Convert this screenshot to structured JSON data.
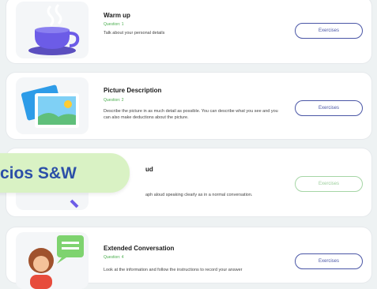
{
  "lessons": [
    {
      "title": "Warm up",
      "question": "Question: 1",
      "description": "Talk about your personal details",
      "button": "Exercises",
      "icon": "coffee-cup-icon"
    },
    {
      "title": "Picture Description",
      "question": "Question: 2",
      "description": "Describe the picture in as much detail as possible. You can describe what you see and you can also make deductions about the picture.",
      "button": "Exercises",
      "icon": "photos-icon"
    },
    {
      "title": "ud",
      "question": "",
      "description": "aph aloud speaking clearly as in a normal conversation.",
      "button": "Exercises",
      "icon": "read-aloud-icon"
    },
    {
      "title": "Extended Conversation",
      "question": "Question: 4",
      "description": "Look at the information and follow the instructions to record your answer",
      "button": "Exercises",
      "icon": "person-chat-icon"
    }
  ],
  "badge": {
    "label": "cios S&W"
  },
  "colors": {
    "accent": "#4a56a6",
    "question_green": "#4caf50",
    "badge_bg": "#d9f2c4",
    "badge_text": "#2c4fa8"
  }
}
